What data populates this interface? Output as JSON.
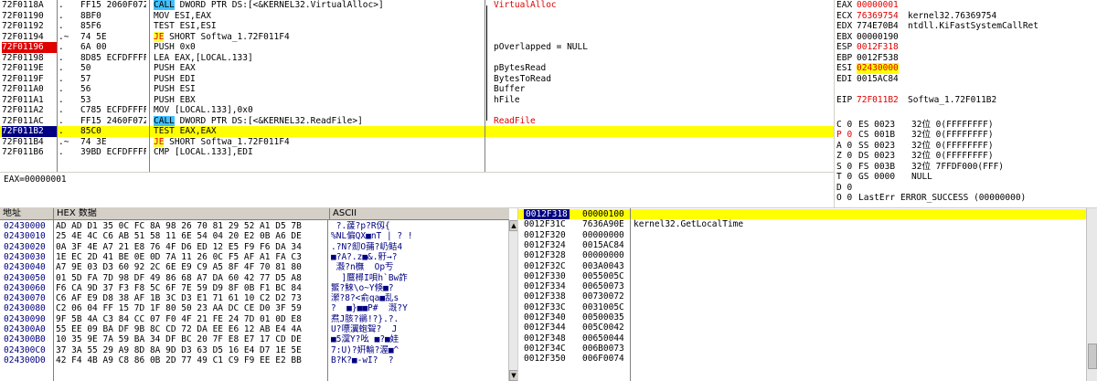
{
  "disasm": [
    {
      "addr": "72F0118A",
      "mark": ".",
      "hex": "FF15 2060F072",
      "ins": [
        {
          "t": "CALL",
          "c": "call"
        },
        {
          "t": " DWORD PTR DS:[<&KERNEL32.VirtualAlloc>]"
        }
      ],
      "cmt": "VirtualAlloc",
      "cmt_red": true,
      "bstart": true
    },
    {
      "addr": "72F01190",
      "mark": ".",
      "hex": "8BF0",
      "ins": [
        {
          "t": "MOV ESI,EAX"
        }
      ],
      "cmt": ""
    },
    {
      "addr": "72F01192",
      "mark": ".",
      "hex": "85F6",
      "ins": [
        {
          "t": "TEST ESI,ESI"
        }
      ],
      "cmt": ""
    },
    {
      "addr": "72F01194",
      "mark": ".~",
      "hex": "74 5E",
      "ins": [
        {
          "t": "JE",
          "c": "je"
        },
        {
          "t": " SHORT Softwa_1.72F011F4"
        }
      ],
      "cmt": ""
    },
    {
      "addr": "72F01196",
      "mark": ".",
      "hex": "6A 00",
      "ins": [
        {
          "t": "PUSH 0x0"
        }
      ],
      "cmt": "pOverlapped = NULL",
      "addr_style": "red",
      "bstart": true
    },
    {
      "addr": "72F01198",
      "mark": ".",
      "hex": "8D85 ECFDFFFF",
      "ins": [
        {
          "t": "LEA EAX,[LOCAL.133]"
        }
      ],
      "cmt": ""
    },
    {
      "addr": "72F0119E",
      "mark": ".",
      "hex": "50",
      "ins": [
        {
          "t": "PUSH EAX"
        }
      ],
      "cmt": "pBytesRead"
    },
    {
      "addr": "72F0119F",
      "mark": ".",
      "hex": "57",
      "ins": [
        {
          "t": "PUSH EDI"
        }
      ],
      "cmt": "BytesToRead"
    },
    {
      "addr": "72F011A0",
      "mark": ".",
      "hex": "56",
      "ins": [
        {
          "t": "PUSH ESI"
        }
      ],
      "cmt": "Buffer"
    },
    {
      "addr": "72F011A1",
      "mark": ".",
      "hex": "53",
      "ins": [
        {
          "t": "PUSH EBX"
        }
      ],
      "cmt": "hFile"
    },
    {
      "addr": "72F011A2",
      "mark": ".",
      "hex": "C785 ECFDFFFF",
      "ins": [
        {
          "t": "MOV [LOCAL.133],0x0"
        }
      ],
      "cmt": ""
    },
    {
      "addr": "72F011AC",
      "mark": ".",
      "hex": "FF15 2460F072",
      "ins": [
        {
          "t": "CALL",
          "c": "call"
        },
        {
          "t": " DWORD PTR DS:[<&KERNEL32.ReadFile>]"
        }
      ],
      "cmt": "ReadFile",
      "cmt_red": true,
      "bend": true
    },
    {
      "addr": "72F011B2",
      "mark": ".",
      "hex": "85C0",
      "ins": [
        {
          "t": "TEST EAX,EAX"
        }
      ],
      "cmt": "",
      "addr_style": "sel",
      "selected": true
    },
    {
      "addr": "72F011B4",
      "mark": ".~",
      "hex": "74 3E",
      "ins": [
        {
          "t": "JE",
          "c": "je"
        },
        {
          "t": " SHORT Softwa_1.72F011F4"
        }
      ],
      "cmt": ""
    },
    {
      "addr": "72F011B6",
      "mark": ".",
      "hex": "39BD ECFDFFFF",
      "ins": [
        {
          "t": "CMP [LOCAL.133],EDI"
        }
      ],
      "cmt": ""
    }
  ],
  "info": {
    "text": "EAX=00000001"
  },
  "registers": [
    {
      "n": "EAX",
      "v": "00000001",
      "d": "",
      "vred": true
    },
    {
      "n": "ECX",
      "v": "76369754",
      "d": "kernel32.76369754",
      "vred": true
    },
    {
      "n": "EDX",
      "v": "774E70B4",
      "d": "ntdll.KiFastSystemCallRet"
    },
    {
      "n": "EBX",
      "v": "00000190",
      "d": ""
    },
    {
      "n": "ESP",
      "v": "0012F318",
      "d": "",
      "vred": true
    },
    {
      "n": "EBP",
      "v": "0012F538",
      "d": ""
    },
    {
      "n": "ESI",
      "v": "02430000",
      "d": "",
      "vhl": true
    },
    {
      "n": "EDI",
      "v": "0015AC84",
      "d": ""
    },
    {
      "n": "",
      "v": "",
      "d": ""
    },
    {
      "n": "EIP",
      "v": "72F011B2",
      "d": "Softwa_1.72F011B2",
      "vred": true
    },
    {
      "n": "",
      "v": "",
      "d": ""
    },
    {
      "n": "C 0",
      "v": "ES 0023",
      "d": "32位 0(FFFFFFFF)"
    },
    {
      "n": "P 0",
      "v": "CS 001B",
      "d": "32位 0(FFFFFFFF)",
      "nred": true
    },
    {
      "n": "A 0",
      "v": "SS 0023",
      "d": "32位 0(FFFFFFFF)"
    },
    {
      "n": "Z 0",
      "v": "DS 0023",
      "d": "32位 0(FFFFFFFF)"
    },
    {
      "n": "S 0",
      "v": "FS 003B",
      "d": "32位 7FFDF000(FFF)"
    },
    {
      "n": "T 0",
      "v": "GS 0000",
      "d": "NULL"
    },
    {
      "n": "D 0",
      "v": "",
      "d": ""
    },
    {
      "n": "O 0",
      "v": "LastErr",
      "d": "ERROR_SUCCESS (00000000)"
    }
  ],
  "dump": {
    "col_addr": "地址",
    "col_hex": "HEX 数据",
    "col_ascii": "ASCII",
    "rows": [
      {
        "a": "02430000",
        "h": "AD AD D1 35 0C FC 8A 98 26 70 81 29 52 A1 D5 7B",
        "s": " ?.蘐?p?R仭{"
      },
      {
        "a": "02430010",
        "h": "25 4E 4C C6 AB 51 58 11 6E 54 04 20 E2 0B A6 DE",
        "s": "%NL偏QX■nT | ? !"
      },
      {
        "a": "02430020",
        "h": "0A 3F 4E A7 21 E8 76 4F D6 ED 12 E5 F9 F6 DA 34",
        "s": ".?N?劎O蒱?屷鲒4"
      },
      {
        "a": "02430030",
        "h": "1E EC 2D 41 BE 0E 0D 7A 11 26 0C F5 AF A1 FA C3",
        "s": "■?A?.z■&.骬→?"
      },
      {
        "a": "02430040",
        "h": "A7 9E 03 D3 60 92 2C 6E E9 C9 A5 8F 4F 70 81 80",
        "s": " 瀫?n橅  Op亐"
      },
      {
        "a": "02430050",
        "h": "01 5D FA 7D 98 DF 49 86 68 A7 DA 60 42 77 D5 A8",
        "s": "  ]鷢樳I唄h`Bw詐"
      },
      {
        "a": "02430060",
        "h": "F6 CA 9D 37 F3 F8 5C 6F 7E 59 D9 8F 0B F1 BC 84",
        "s": "鰵?鯠\\o~Y倏■?"
      },
      {
        "a": "02430070",
        "h": "C6 AF E9 D8 38 AF 1B 3C D3 E1 71 61 10 C2 D2 73",
        "s": "瀠?8?<俞qa■乱s"
      },
      {
        "a": "02430080",
        "h": "C2 06 04 FF 15 7D 1F 80 50 23 AA DC CE D0 3F 59",
        "s": "?  ■}■■P#  漑?Y"
      },
      {
        "a": "02430090",
        "h": "9F 5B 4A C3 84 CC 07 F0 4F 21 FE 24 7D 01 0D E8",
        "s": "焄J胲?鶲!?}.?."
      },
      {
        "a": "024300A0",
        "h": "55 EE 09 BA DF 9B 8C CD 72 DA EE E6 12 AB E4 4A",
        "s": "U?嘌瀷蚫聟?  J"
      },
      {
        "a": "024300B0",
        "h": "10 35 9E 7A 59 BA 34 DF BC 20 7F E8 E7 17 CD DE",
        "s": "■5灙Y?吆 ■?■娃"
      },
      {
        "a": "024300C0",
        "h": "37 3A 55 29 A9 8D 8A 9D D3 63 D5 16 E4 D7 1E 5E",
        "s": "7:U)?姸輸?渥■^"
      },
      {
        "a": "024300D0",
        "h": "42 F4 4B A9 C8 86 0B 2D 77 49 C1 C9 F9 EE E2 BB",
        "s": "B?K?■-wI?  ?"
      }
    ]
  },
  "stack": [
    {
      "a": "0012F318",
      "v": "00000100",
      "c": "",
      "sel": true
    },
    {
      "a": "0012F31C",
      "v": "7636A90E",
      "c": "kernel32.GetLocalTime"
    },
    {
      "a": "0012F320",
      "v": "00000000",
      "c": ""
    },
    {
      "a": "0012F324",
      "v": "0015AC84",
      "c": ""
    },
    {
      "a": "0012F328",
      "v": "00000000",
      "c": ""
    },
    {
      "a": "0012F32C",
      "v": "003A0043",
      "c": ""
    },
    {
      "a": "0012F330",
      "v": "0055005C",
      "c": ""
    },
    {
      "a": "0012F334",
      "v": "00650073",
      "c": ""
    },
    {
      "a": "0012F338",
      "v": "00730072",
      "c": ""
    },
    {
      "a": "0012F33C",
      "v": "0031005C",
      "c": ""
    },
    {
      "a": "0012F340",
      "v": "00500035",
      "c": ""
    },
    {
      "a": "0012F344",
      "v": "005C0042",
      "c": ""
    },
    {
      "a": "0012F348",
      "v": "00650044",
      "c": ""
    },
    {
      "a": "0012F34C",
      "v": "006B0073",
      "c": ""
    },
    {
      "a": "0012F350",
      "v": "006F0074",
      "c": ""
    }
  ]
}
